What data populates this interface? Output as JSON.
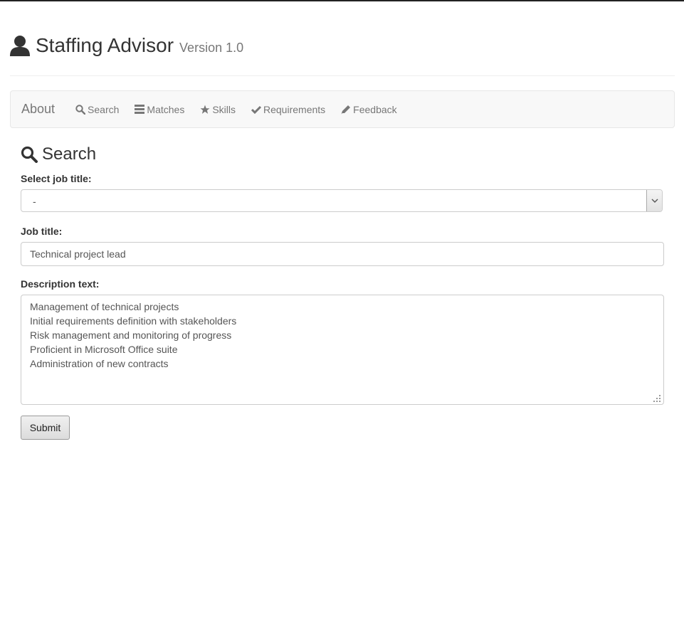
{
  "header": {
    "title": "Staffing Advisor",
    "version": "Version 1.0",
    "icon": "user-icon"
  },
  "navbar": {
    "brand": "About",
    "items": [
      {
        "label": "Search",
        "icon": "search-icon"
      },
      {
        "label": "Matches",
        "icon": "list-icon"
      },
      {
        "label": "Skills",
        "icon": "star-icon"
      },
      {
        "label": "Requirements",
        "icon": "check-icon"
      },
      {
        "label": "Feedback",
        "icon": "pencil-icon"
      }
    ]
  },
  "section": {
    "title": "Search",
    "icon": "search-icon"
  },
  "form": {
    "select_label": "Select job title:",
    "select_value": "-",
    "job_title_label": "Job title:",
    "job_title_value": "Technical project lead",
    "description_label": "Description text:",
    "description_value": "Management of technical projects\nInitial requirements definition with stakeholders\nRisk management and monitoring of progress\nProficient in Microsoft Office suite\nAdministration of new contracts",
    "submit_label": "Submit"
  },
  "colors": {
    "nav_bg": "#f8f8f8",
    "nav_text": "#777777",
    "text": "#333333",
    "input_border": "#cccccc"
  }
}
